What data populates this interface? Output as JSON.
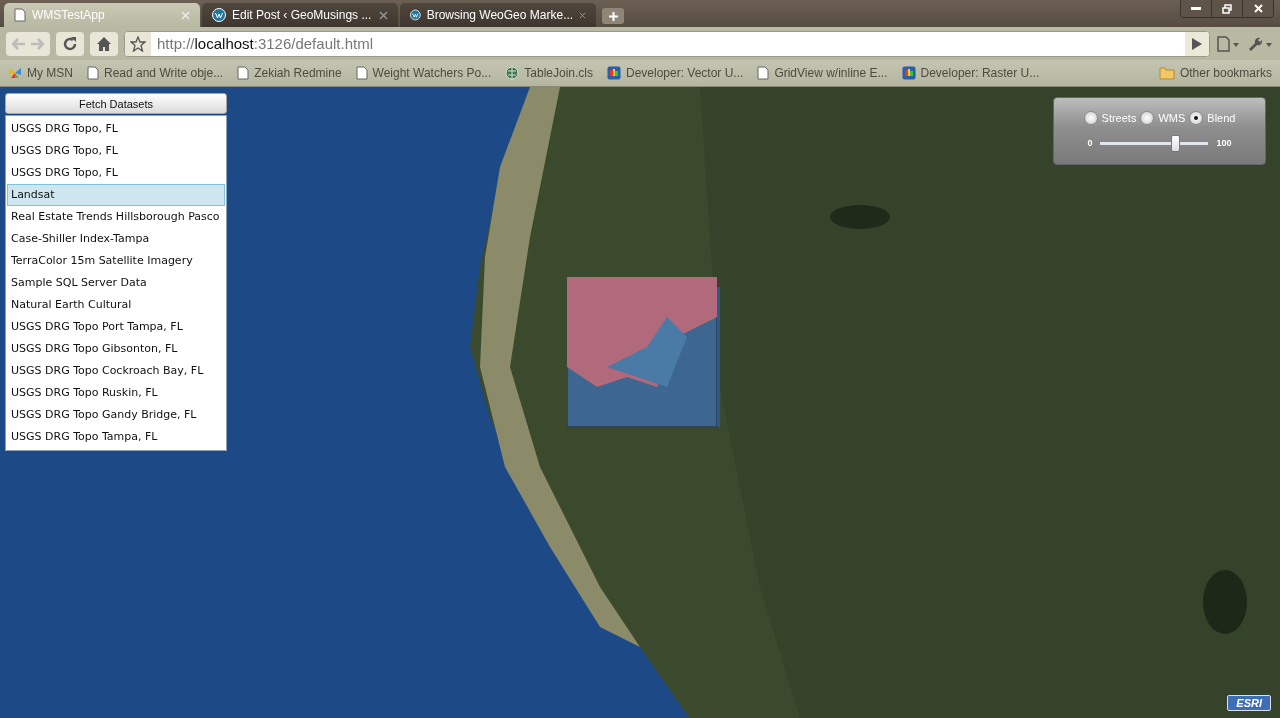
{
  "browser": {
    "tabs": [
      {
        "title": "WMSTestApp",
        "kind": "page",
        "selected": true
      },
      {
        "title": "Edit Post ‹ GeoMusings ...",
        "kind": "wordpress",
        "selected": false
      },
      {
        "title": "Browsing WeoGeo Marke...",
        "kind": "wordpress",
        "selected": false
      }
    ],
    "address": {
      "scheme": "http://",
      "host": "localhost",
      "rest": ":3126/default.html"
    },
    "bookmarks": [
      {
        "label": "My MSN",
        "kind": "butterfly"
      },
      {
        "label": "Read and Write obje...",
        "kind": "page"
      },
      {
        "label": "Zekiah Redmine",
        "kind": "page"
      },
      {
        "label": "Weight Watchers Po...",
        "kind": "page"
      },
      {
        "label": "TableJoin.cls",
        "kind": "globe"
      },
      {
        "label": "Developer: Vector U...",
        "kind": "app"
      },
      {
        "label": "GridView w/inline E...",
        "kind": "page"
      },
      {
        "label": "Developer: Raster U...",
        "kind": "app"
      }
    ],
    "other_bookmarks": "Other bookmarks"
  },
  "datasets": {
    "button": "Fetch Datasets",
    "items": [
      {
        "label": "USGS DRG Topo, FL",
        "selected": false
      },
      {
        "label": "USGS DRG Topo, FL",
        "selected": false
      },
      {
        "label": "USGS DRG Topo, FL",
        "selected": false
      },
      {
        "label": "Landsat",
        "selected": true
      },
      {
        "label": "Real Estate Trends Hillsborough Pasco",
        "selected": false
      },
      {
        "label": "Case-Shiller Index-Tampa",
        "selected": false
      },
      {
        "label": "TerraColor 15m Satellite Imagery",
        "selected": false
      },
      {
        "label": "Sample SQL Server Data",
        "selected": false
      },
      {
        "label": "Natural Earth Cultural",
        "selected": false
      },
      {
        "label": "USGS DRG Topo Port Tampa, FL",
        "selected": false
      },
      {
        "label": "USGS DRG Topo Gibsonton, FL",
        "selected": false
      },
      {
        "label": "USGS DRG Topo Cockroach Bay, FL",
        "selected": false
      },
      {
        "label": "USGS DRG Topo Ruskin, FL",
        "selected": false
      },
      {
        "label": "USGS DRG Topo Gandy Bridge, FL",
        "selected": false
      },
      {
        "label": "USGS DRG Topo Tampa, FL",
        "selected": false
      }
    ]
  },
  "layer_control": {
    "options": [
      {
        "label": "Streets",
        "selected": false
      },
      {
        "label": "WMS",
        "selected": false
      },
      {
        "label": "Blend",
        "selected": true
      }
    ],
    "slider": {
      "min": "0",
      "max": "100",
      "level": 0.69
    }
  },
  "logo": "ESRI"
}
